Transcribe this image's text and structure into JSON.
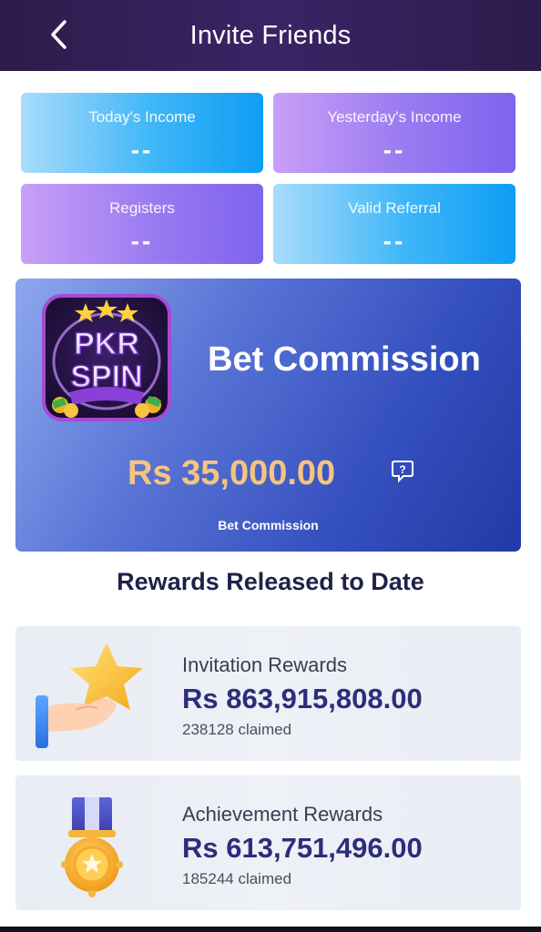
{
  "header": {
    "title": "Invite Friends",
    "back_icon": "chevron-left-icon"
  },
  "stats": [
    {
      "label": "Today's Income",
      "value": "--",
      "color": "#3eb6f7"
    },
    {
      "label": "Yesterday's Income",
      "value": "--",
      "color": "#9a7af1"
    },
    {
      "label": "Registers",
      "value": "--",
      "color": "#9a7af1"
    },
    {
      "label": "Valid Referral",
      "value": "--",
      "color": "#3eb6f7"
    }
  ],
  "commission": {
    "logo_text_top": "PKR",
    "logo_text_bottom": "SPIN",
    "title": "Bet Commission",
    "amount": "Rs 35,000.00",
    "subtitle": "Bet Commission",
    "help_icon": "question-bubble-icon",
    "amount_color": "#f7c47d"
  },
  "rewards": {
    "section_title": "Rewards Released to Date",
    "items": [
      {
        "name": "Invitation Rewards",
        "amount": "Rs 863,915,808.00",
        "claimed": "238128 claimed",
        "icon": "hand-star-icon"
      },
      {
        "name": "Achievement Rewards",
        "amount": "Rs 613,751,496.00",
        "claimed": "185244 claimed",
        "icon": "medal-icon"
      }
    ]
  }
}
